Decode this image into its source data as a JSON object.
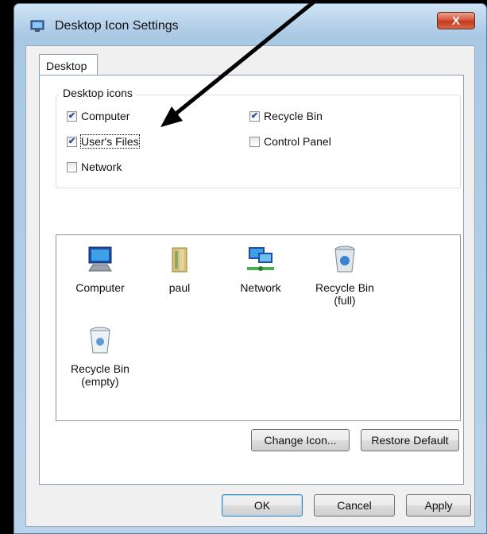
{
  "window": {
    "title": "Desktop Icon Settings",
    "close_label": "X"
  },
  "tabs": [
    {
      "label": "Desktop",
      "selected": true
    }
  ],
  "desktop_icons_group": {
    "title": "Desktop icons",
    "checkboxes": [
      {
        "label": "Computer",
        "checked": true
      },
      {
        "label": "User's Files",
        "checked": true
      },
      {
        "label": "Network",
        "checked": false
      },
      {
        "label": "Recycle Bin",
        "checked": true
      },
      {
        "label": "Control Panel",
        "checked": false
      }
    ]
  },
  "icon_list": [
    {
      "label": "Computer",
      "icon": "computer-icon"
    },
    {
      "label": "paul",
      "icon": "user-folder-icon"
    },
    {
      "label": "Network",
      "icon": "network-icon"
    },
    {
      "label": "Recycle Bin\n(full)",
      "icon": "recycle-bin-full-icon"
    },
    {
      "label": "Recycle Bin\n(empty)",
      "icon": "recycle-bin-empty-icon"
    }
  ],
  "buttons": {
    "change_icon": "Change Icon...",
    "restore_default": "Restore Default",
    "ok": "OK",
    "cancel": "Cancel",
    "apply": "Apply"
  },
  "colors": {
    "title_bar": "#b9d3ea",
    "close_button": "#c23a1f",
    "check_mark": "#2b4e8c",
    "default_button_border": "#3c7fb1"
  }
}
